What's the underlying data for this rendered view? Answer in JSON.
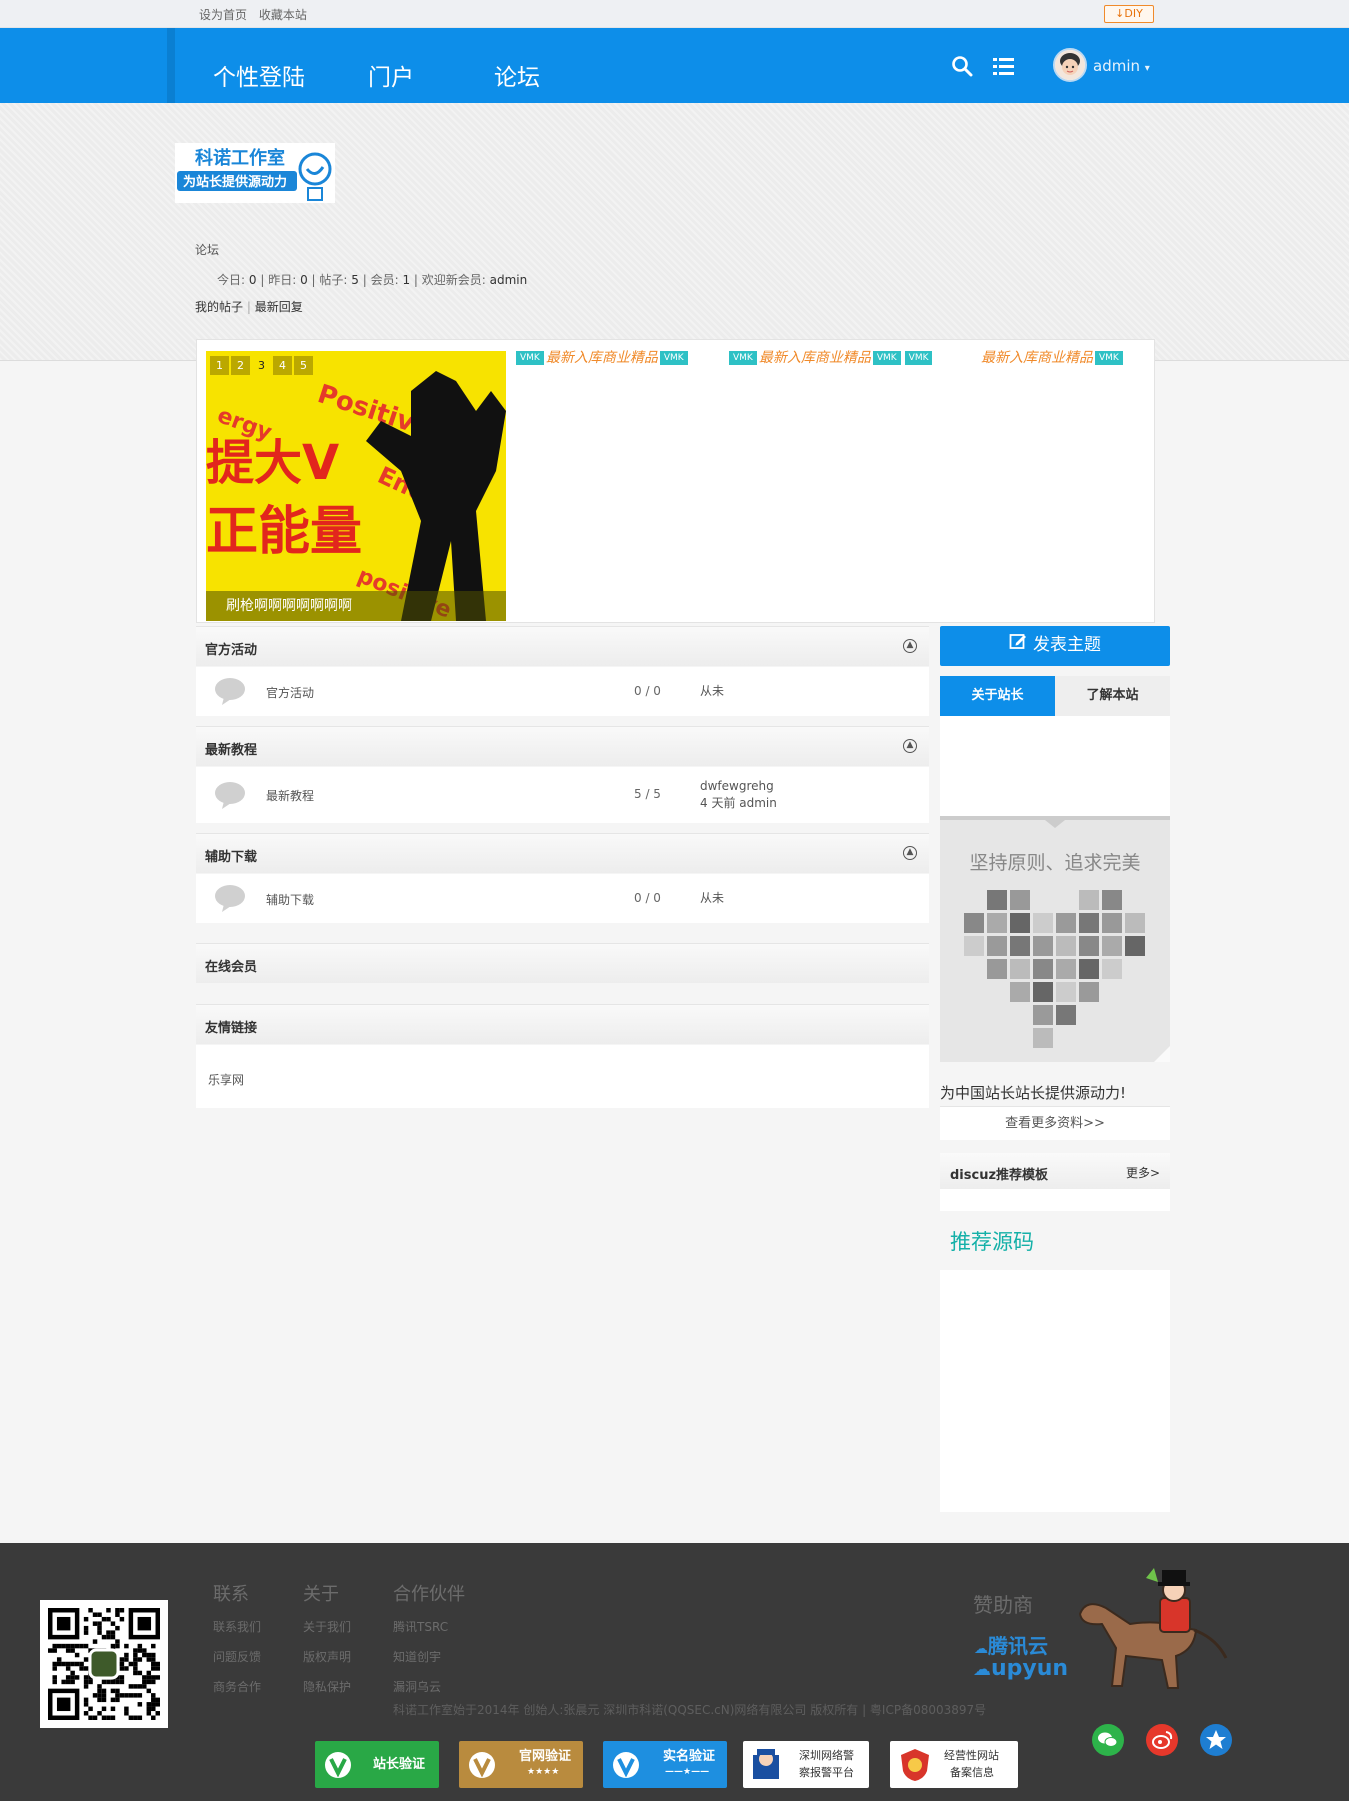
{
  "topbar": {
    "set_home": "设为首页",
    "bookmark": "收藏本站",
    "diy": "DIY"
  },
  "nav": {
    "items": [
      "个性登陆",
      "门户",
      "论坛"
    ],
    "user": "admin"
  },
  "header": {
    "logo_line1": "科诺工作室",
    "logo_line2": "为站长提供源动力",
    "breadcrumb": "论坛",
    "stats": {
      "today_label": "今日:",
      "today": "0",
      "yesterday_label": "昨日:",
      "yesterday": "0",
      "posts_label": "帖子:",
      "posts": "5",
      "members_label": "会员:",
      "members": "1",
      "welcome_label": "欢迎新会员:",
      "welcome_user": "admin"
    },
    "my_posts": "我的帖子",
    "latest_replies": "最新回复"
  },
  "slider": {
    "pages": [
      "1",
      "2",
      "3",
      "4",
      "5"
    ],
    "active_page": "3",
    "caption": "刷枪啊啊啊啊啊啊啊",
    "big_text_1": "提大V",
    "big_text_2": "正能量",
    "marquee_text": "最新入库商业精品",
    "tag": "VMK"
  },
  "groups": [
    {
      "title": "官方活动",
      "forum": "官方活动",
      "count": "0 / 0",
      "last_line1": "从未",
      "last_line2": ""
    },
    {
      "title": "最新教程",
      "forum": "最新教程",
      "count": "5 / 5",
      "last_line1": "dwfewgrehg",
      "last_line2": "4 天前 admin"
    },
    {
      "title": "辅助下载",
      "forum": "辅助下载",
      "count": "0 / 0",
      "last_line1": "从未",
      "last_line2": ""
    }
  ],
  "online": {
    "title": "在线会员"
  },
  "links": {
    "title": "友情链接",
    "item": "乐享网"
  },
  "sidebar": {
    "post_button": "发表主题",
    "tab_about": "关于站长",
    "tab_learn": "了解本站",
    "heart_title": "坚持原则、追求完美",
    "slogan": "为中国站长站长提供源动力!",
    "more_info": "查看更多资料>>",
    "rec_title": "discuz推荐模板",
    "rec_more": "更多>",
    "source_title": "推荐源码"
  },
  "footer": {
    "col1": {
      "head": "联系",
      "links": [
        "联系我们",
        "问题反馈",
        "商务合作"
      ]
    },
    "col2": {
      "head": "关于",
      "links": [
        "关于我们",
        "版权声明",
        "隐私保护"
      ]
    },
    "col3": {
      "head": "合作伙伴",
      "links": [
        "腾讯TSRC",
        "知道创宇",
        "漏洞乌云"
      ]
    },
    "copyright": "科诺工作室始于2014年 创始人:张晨元 深圳市科诺(QQSEC.cN)网络有限公司 版权所有 | 粤ICP备08003897号",
    "sponsor": "赞助商",
    "sponsor1": "腾讯云",
    "sponsor2": "upyun",
    "badges": {
      "b1": "站长验证",
      "b2": "官网验证",
      "b3": "实名验证",
      "b4_line1": "深圳网络警",
      "b4_line2": "察报警平台",
      "b5_line1": "经营性网站",
      "b5_line2": "备案信息"
    }
  },
  "colors": {
    "primary": "#0d8ee9",
    "accent_orange": "#f08a2a",
    "teal": "#14b0a8",
    "footer_bg": "#3a3a3a"
  }
}
